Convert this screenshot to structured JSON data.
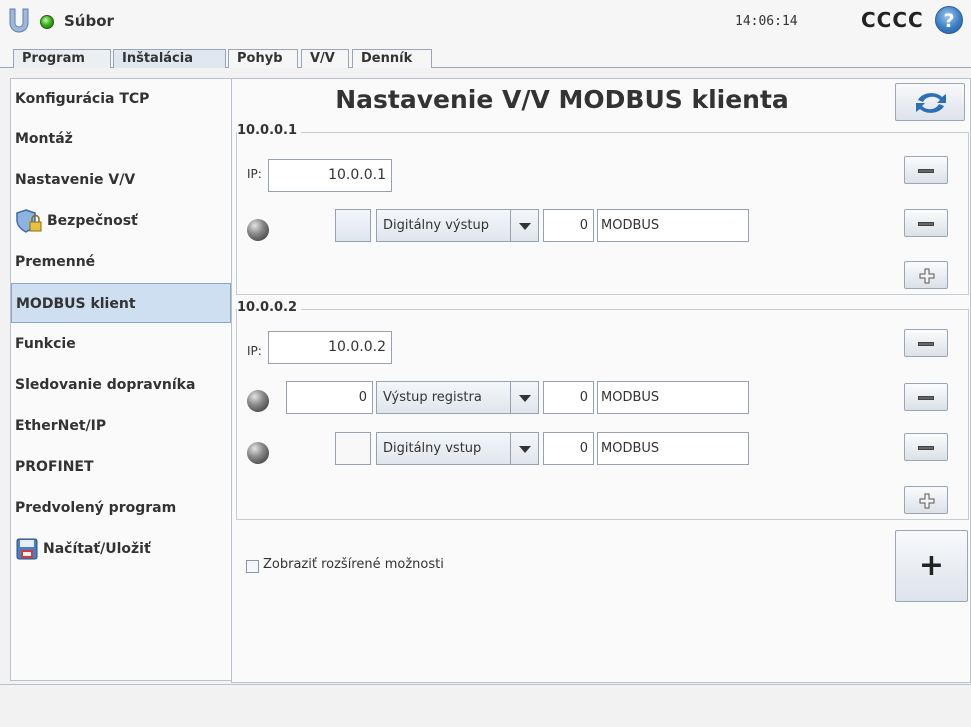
{
  "header": {
    "file_menu": "Súbor",
    "clock": "14:06:14",
    "robot_name": "CCCC",
    "help": "?"
  },
  "tabs": [
    {
      "label": "Program"
    },
    {
      "label": "Inštalácia"
    },
    {
      "label": "Pohyb"
    },
    {
      "label": "V/V"
    },
    {
      "label": "Denník"
    }
  ],
  "sidebar": {
    "items": [
      {
        "label": "Konfigurácia TCP"
      },
      {
        "label": "Montáž"
      },
      {
        "label": "Nastavenie V/V"
      },
      {
        "label": "Bezpečnosť",
        "icon": "shield-lock-icon"
      },
      {
        "label": "Premenné"
      },
      {
        "label": "MODBUS klient"
      },
      {
        "label": "Funkcie"
      },
      {
        "label": "Sledovanie dopravníka"
      },
      {
        "label": "EtherNet/IP"
      },
      {
        "label": "PROFINET"
      },
      {
        "label": "Predvolený program"
      },
      {
        "label": "Načítať/Uložiť",
        "icon": "floppy-disk-icon"
      }
    ],
    "active_index": 5
  },
  "main": {
    "title": "Nastavenie V/V MODBUS klienta",
    "ip_label": "IP:",
    "units": [
      {
        "name": "10.0.0.1",
        "ip": "10.0.0.1",
        "signals": [
          {
            "value": "",
            "type": "Digitálny výstup",
            "address": "0",
            "name": "MODBUS"
          }
        ]
      },
      {
        "name": "10.0.0.2",
        "ip": "10.0.0.2",
        "signals": [
          {
            "value": "0",
            "type": "Výstup registra",
            "address": "0",
            "name": "MODBUS"
          },
          {
            "value": "",
            "type": "Digitálny vstup",
            "address": "0",
            "name": "MODBUS"
          }
        ]
      }
    ],
    "advanced_options_label": "Zobraziť rozšírené možnosti",
    "add_unit_label": "+"
  },
  "colors": {
    "active_tab": "#dfe7f0",
    "active_sidebar": "#cfdff2",
    "accent_blue": "#3b7ec4"
  }
}
